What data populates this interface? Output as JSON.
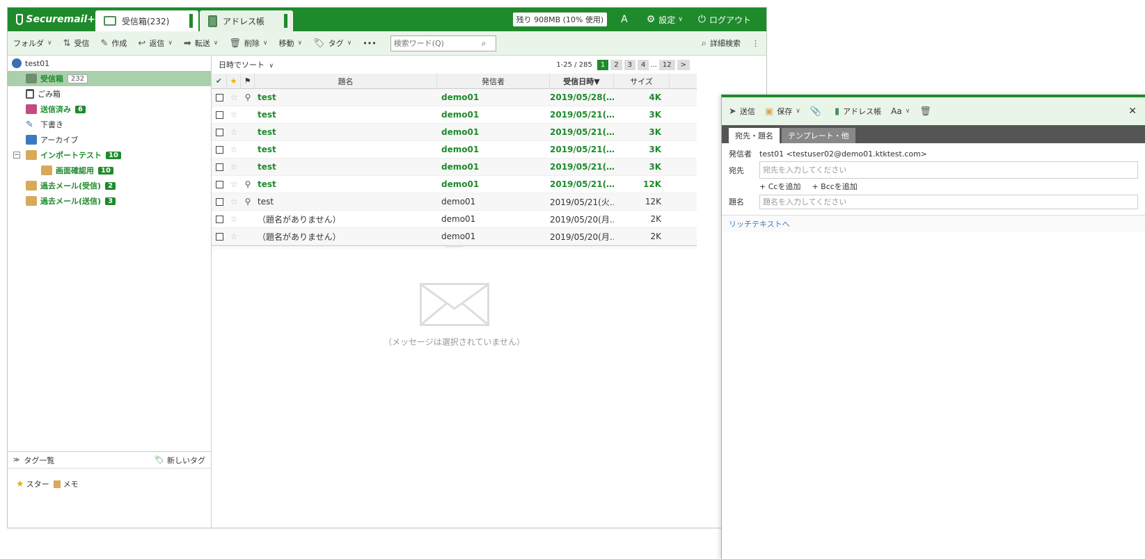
{
  "header": {
    "logo": "Securemail+",
    "tabs": [
      {
        "label": "受信箱(232)"
      },
      {
        "label": "アドレス帳"
      }
    ],
    "quota": "残り 908MB (10% 使用)",
    "settings": "設定",
    "logout": "ログアウト"
  },
  "toolbar": {
    "folder": "フォルダ",
    "receive": "受信",
    "compose": "作成",
    "reply": "返信",
    "forward": "転送",
    "delete": "削除",
    "move": "移動",
    "tag": "タグ",
    "more": "•••",
    "search_placeholder": "検索ワード(Q)",
    "advanced_search": "詳細検索"
  },
  "sidebar": {
    "account": "test01",
    "folders": [
      {
        "label": "受信箱",
        "count": "232"
      },
      {
        "label": "ごみ箱"
      },
      {
        "label": "送信済み",
        "count": "6"
      },
      {
        "label": "下書き"
      },
      {
        "label": "アーカイブ"
      },
      {
        "label": "インポートテスト",
        "count": "10"
      },
      {
        "label": "画面確認用",
        "count": "10"
      },
      {
        "label": "過去メール(受信)",
        "count": "2"
      },
      {
        "label": "過去メール(送信)",
        "count": "3"
      }
    ],
    "tags_title": "タグ一覧",
    "new_tag": "新しいタグ",
    "tags": [
      "スター",
      "メモ"
    ]
  },
  "list": {
    "sort": "日時でソート",
    "range": "1-25 / 285",
    "pages": [
      "1",
      "2",
      "3",
      "4",
      "...",
      "12",
      ">"
    ],
    "columns": {
      "subject": "題名",
      "from": "発信者",
      "date": "受信日時▼",
      "size": "サイズ"
    },
    "rows": [
      {
        "subject": "test",
        "from": "demo01",
        "date": "2019/05/28(…",
        "size": "4K",
        "unread": true,
        "attach": true
      },
      {
        "subject": "test",
        "from": "demo01",
        "date": "2019/05/21(…",
        "size": "3K",
        "unread": true,
        "attach": false
      },
      {
        "subject": "test",
        "from": "demo01",
        "date": "2019/05/21(…",
        "size": "3K",
        "unread": true,
        "attach": false
      },
      {
        "subject": "test",
        "from": "demo01",
        "date": "2019/05/21(…",
        "size": "3K",
        "unread": true,
        "attach": false
      },
      {
        "subject": "test",
        "from": "demo01",
        "date": "2019/05/21(…",
        "size": "3K",
        "unread": true,
        "attach": false
      },
      {
        "subject": "test",
        "from": "demo01",
        "date": "2019/05/21(…",
        "size": "12K",
        "unread": true,
        "attach": true
      },
      {
        "subject": "test",
        "from": "demo01",
        "date": "2019/05/21(火…",
        "size": "12K",
        "unread": false,
        "attach": true
      },
      {
        "subject": "（題名がありません）",
        "from": "demo01",
        "date": "2019/05/20(月…",
        "size": "2K",
        "unread": false,
        "attach": false
      },
      {
        "subject": "（題名がありません）",
        "from": "demo01",
        "date": "2019/05/20(月…",
        "size": "2K",
        "unread": false,
        "attach": false
      }
    ],
    "empty_message": "（メッセージは選択されていません）"
  },
  "compose": {
    "send": "送信",
    "save": "保存",
    "address_book": "アドレス帳",
    "font": "Aa",
    "tabs": [
      "宛先・題名",
      "テンプレート・他"
    ],
    "from_label": "発信者",
    "from_value": "test01 <testuser02@demo01.ktktest.com>",
    "to_label": "宛先",
    "to_placeholder": "宛先を入力してください",
    "add_cc": "+ Ccを追加",
    "add_bcc": "+ Bccを追加",
    "subject_label": "題名",
    "subject_placeholder": "題名を入力してください",
    "rich_text": "リッチテキストへ"
  }
}
